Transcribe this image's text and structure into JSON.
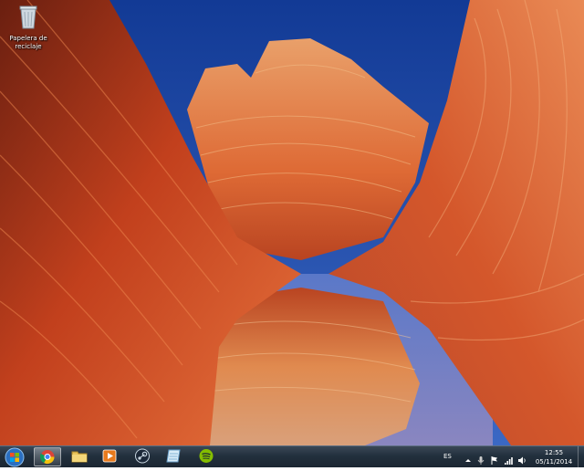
{
  "desktop": {
    "icons": [
      {
        "label_line1": "Papelera de",
        "label_line2": "reciclaje",
        "icon": "recycle-bin-icon"
      }
    ]
  },
  "taskbar": {
    "start_icon": "windows-start-orb-icon",
    "pinned": [
      {
        "name": "chrome",
        "icon": "chrome-icon",
        "active": true
      },
      {
        "name": "file-explorer",
        "icon": "folder-icon",
        "active": false
      },
      {
        "name": "media-player",
        "icon": "media-player-icon",
        "active": false
      },
      {
        "name": "steam",
        "icon": "steam-icon",
        "active": false
      },
      {
        "name": "app",
        "icon": "notepad-icon",
        "active": false
      },
      {
        "name": "spotify",
        "icon": "spotify-icon",
        "active": false
      }
    ],
    "tray": {
      "language": "ES",
      "time": "12:55",
      "date": "05/11/2014"
    }
  },
  "colors": {
    "taskbar": "#22303d",
    "sky": "#1d3f8f",
    "rock": "#d9552a"
  }
}
